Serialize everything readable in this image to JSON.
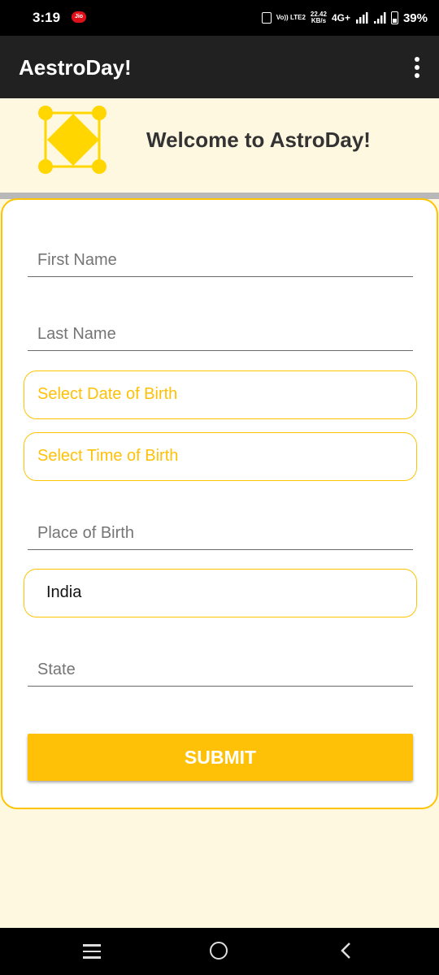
{
  "status_bar": {
    "time": "3:19",
    "carrier_badge": "Jio",
    "volte": "Vo)) LTE2",
    "speed_value": "22.42",
    "speed_unit": "KB/s",
    "network": "4G+",
    "battery": "39%"
  },
  "app_bar": {
    "title": "AestroDay!"
  },
  "header": {
    "welcome_text": "Welcome to AstroDay!"
  },
  "form": {
    "first_name_placeholder": "First Name",
    "last_name_placeholder": "Last Name",
    "dob_button": "Select Date of Birth",
    "tob_button": "Select Time of Birth",
    "place_placeholder": "Place of Birth",
    "country_value": "India",
    "state_placeholder": "State",
    "submit_label": "SUBMIT"
  },
  "colors": {
    "accent": "#ffc107",
    "background": "#fff8e1",
    "app_bar": "#212121"
  },
  "icons": {
    "logo": "astro-diamond-logo",
    "overflow": "more-vert-icon",
    "nav_recents": "menu-lines-icon",
    "nav_home": "circle-home-icon",
    "nav_back": "chevron-left-icon"
  }
}
